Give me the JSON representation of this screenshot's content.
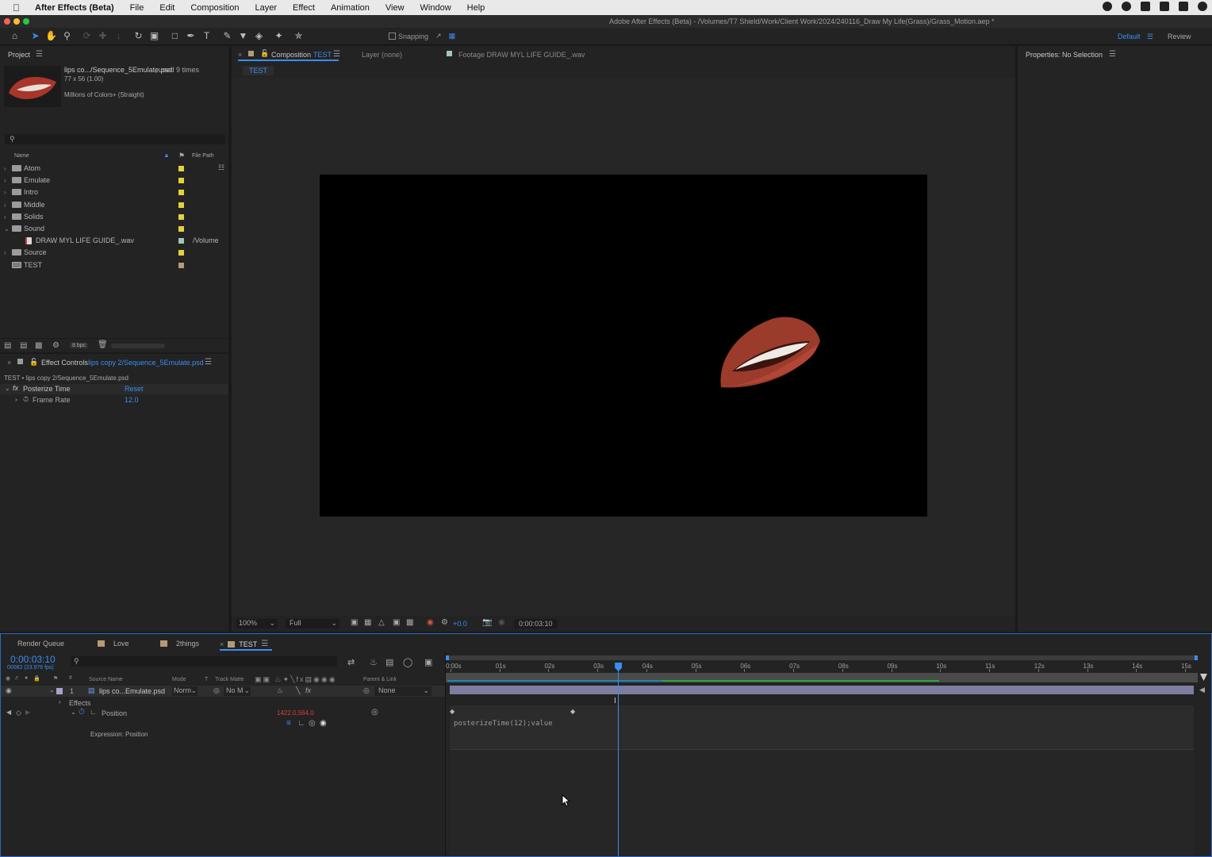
{
  "menubar": {
    "app_name": "After Effects (Beta)",
    "items": [
      "File",
      "Edit",
      "Composition",
      "Layer",
      "Effect",
      "Animation",
      "View",
      "Window",
      "Help"
    ]
  },
  "window": {
    "title": "Adobe After Effects (Beta) - /Volumes/T7 Shield/Work/Client Work/2024/240116_Draw My Life(Grass)/Grass_Motion.aep *"
  },
  "toolbar": {
    "snapping_label": "Snapping",
    "workspace_default": "Default",
    "workspace_review": "Review"
  },
  "project": {
    "tab_label": "Project",
    "selected_item_name": "lips co.../Sequence_5Emulate.psd",
    "selected_item_used": ", used 9 times",
    "selected_item_dims": "77 x 56 (1.00)",
    "selected_item_colors": "Millions of Colors+ (Straight)",
    "col_name": "Name",
    "col_filepath": "File Path",
    "items": [
      {
        "name": "Atom",
        "type": "folder",
        "label_color": "#e3d23c"
      },
      {
        "name": "Emulate",
        "type": "folder",
        "label_color": "#e3d23c"
      },
      {
        "name": "Intro",
        "type": "folder",
        "label_color": "#e3d23c"
      },
      {
        "name": "Middle",
        "type": "folder",
        "label_color": "#e3d23c"
      },
      {
        "name": "Solids",
        "type": "folder",
        "label_color": "#e3d23c"
      },
      {
        "name": "Sound",
        "type": "folder-open",
        "label_color": "#e3d23c"
      },
      {
        "name": "DRAW MYL LIFE GUIDE_.wav",
        "type": "audio",
        "label_color": "#9fc7b5",
        "path": "/Volume"
      },
      {
        "name": "Source",
        "type": "folder",
        "label_color": "#e3d23c"
      },
      {
        "name": "TEST",
        "type": "comp",
        "label_color": "#b59a78"
      }
    ],
    "bpc_label": "8 bpc"
  },
  "effect_controls": {
    "tab_label": "Effect Controls",
    "tab_layer": "lips copy 2/Sequence_5Emulate.psd",
    "breadcrumb": "TEST • lips copy 2/Sequence_5Emulate.psd",
    "effect_name": "Posterize Time",
    "reset_label": "Reset",
    "param_name": "Frame Rate",
    "param_value": "12.0"
  },
  "composition": {
    "tab_label": "Composition",
    "tab_comp_name": "TEST",
    "layer_tab": "Layer (none)",
    "footage_tab": "Footage DRAW MYL LIFE GUIDE_.wav",
    "sub_tab": "TEST",
    "zoom": "100%",
    "resolution": "Full",
    "exposure": "+0.0",
    "timecode": "0:00:03:10"
  },
  "properties": {
    "tab_label": "Properties: No Selection"
  },
  "timeline": {
    "tabs": [
      "Render Queue",
      "Love",
      "2things",
      "TEST"
    ],
    "tab_colors": [
      "",
      "#b59a78",
      "#b59a78",
      "#b59a78"
    ],
    "timecode": "0:00:03:10",
    "fps": "00082 (23.976 fps)",
    "col_source_name": "Source Name",
    "col_mode": "Mode",
    "col_t": "T",
    "col_track_matte": "Track Matte",
    "col_parent": "Parent & Link",
    "layer_number": "1",
    "layer_name": "lips co...Emulate.psd",
    "layer_mode": "Norm",
    "layer_matte": "No M",
    "layer_parent": "None",
    "effects_label": "Effects",
    "position_label": "Position",
    "position_value": "1422.0,564.0",
    "expression_label": "Expression: Position",
    "expression_text": "posterizeTime(12);value",
    "ruler_labels": [
      "0:00s",
      "01s",
      "02s",
      "03s",
      "04s",
      "05s",
      "06s",
      "07s",
      "08s",
      "09s",
      "10s",
      "11s",
      "12s",
      "13s",
      "14s",
      "15s"
    ],
    "playhead_seconds": 3.42,
    "duration_seconds": 15
  },
  "colors": {
    "accent_blue": "#3a8df2",
    "label_yellow": "#e3d23c",
    "position_red": "#d8403a"
  }
}
